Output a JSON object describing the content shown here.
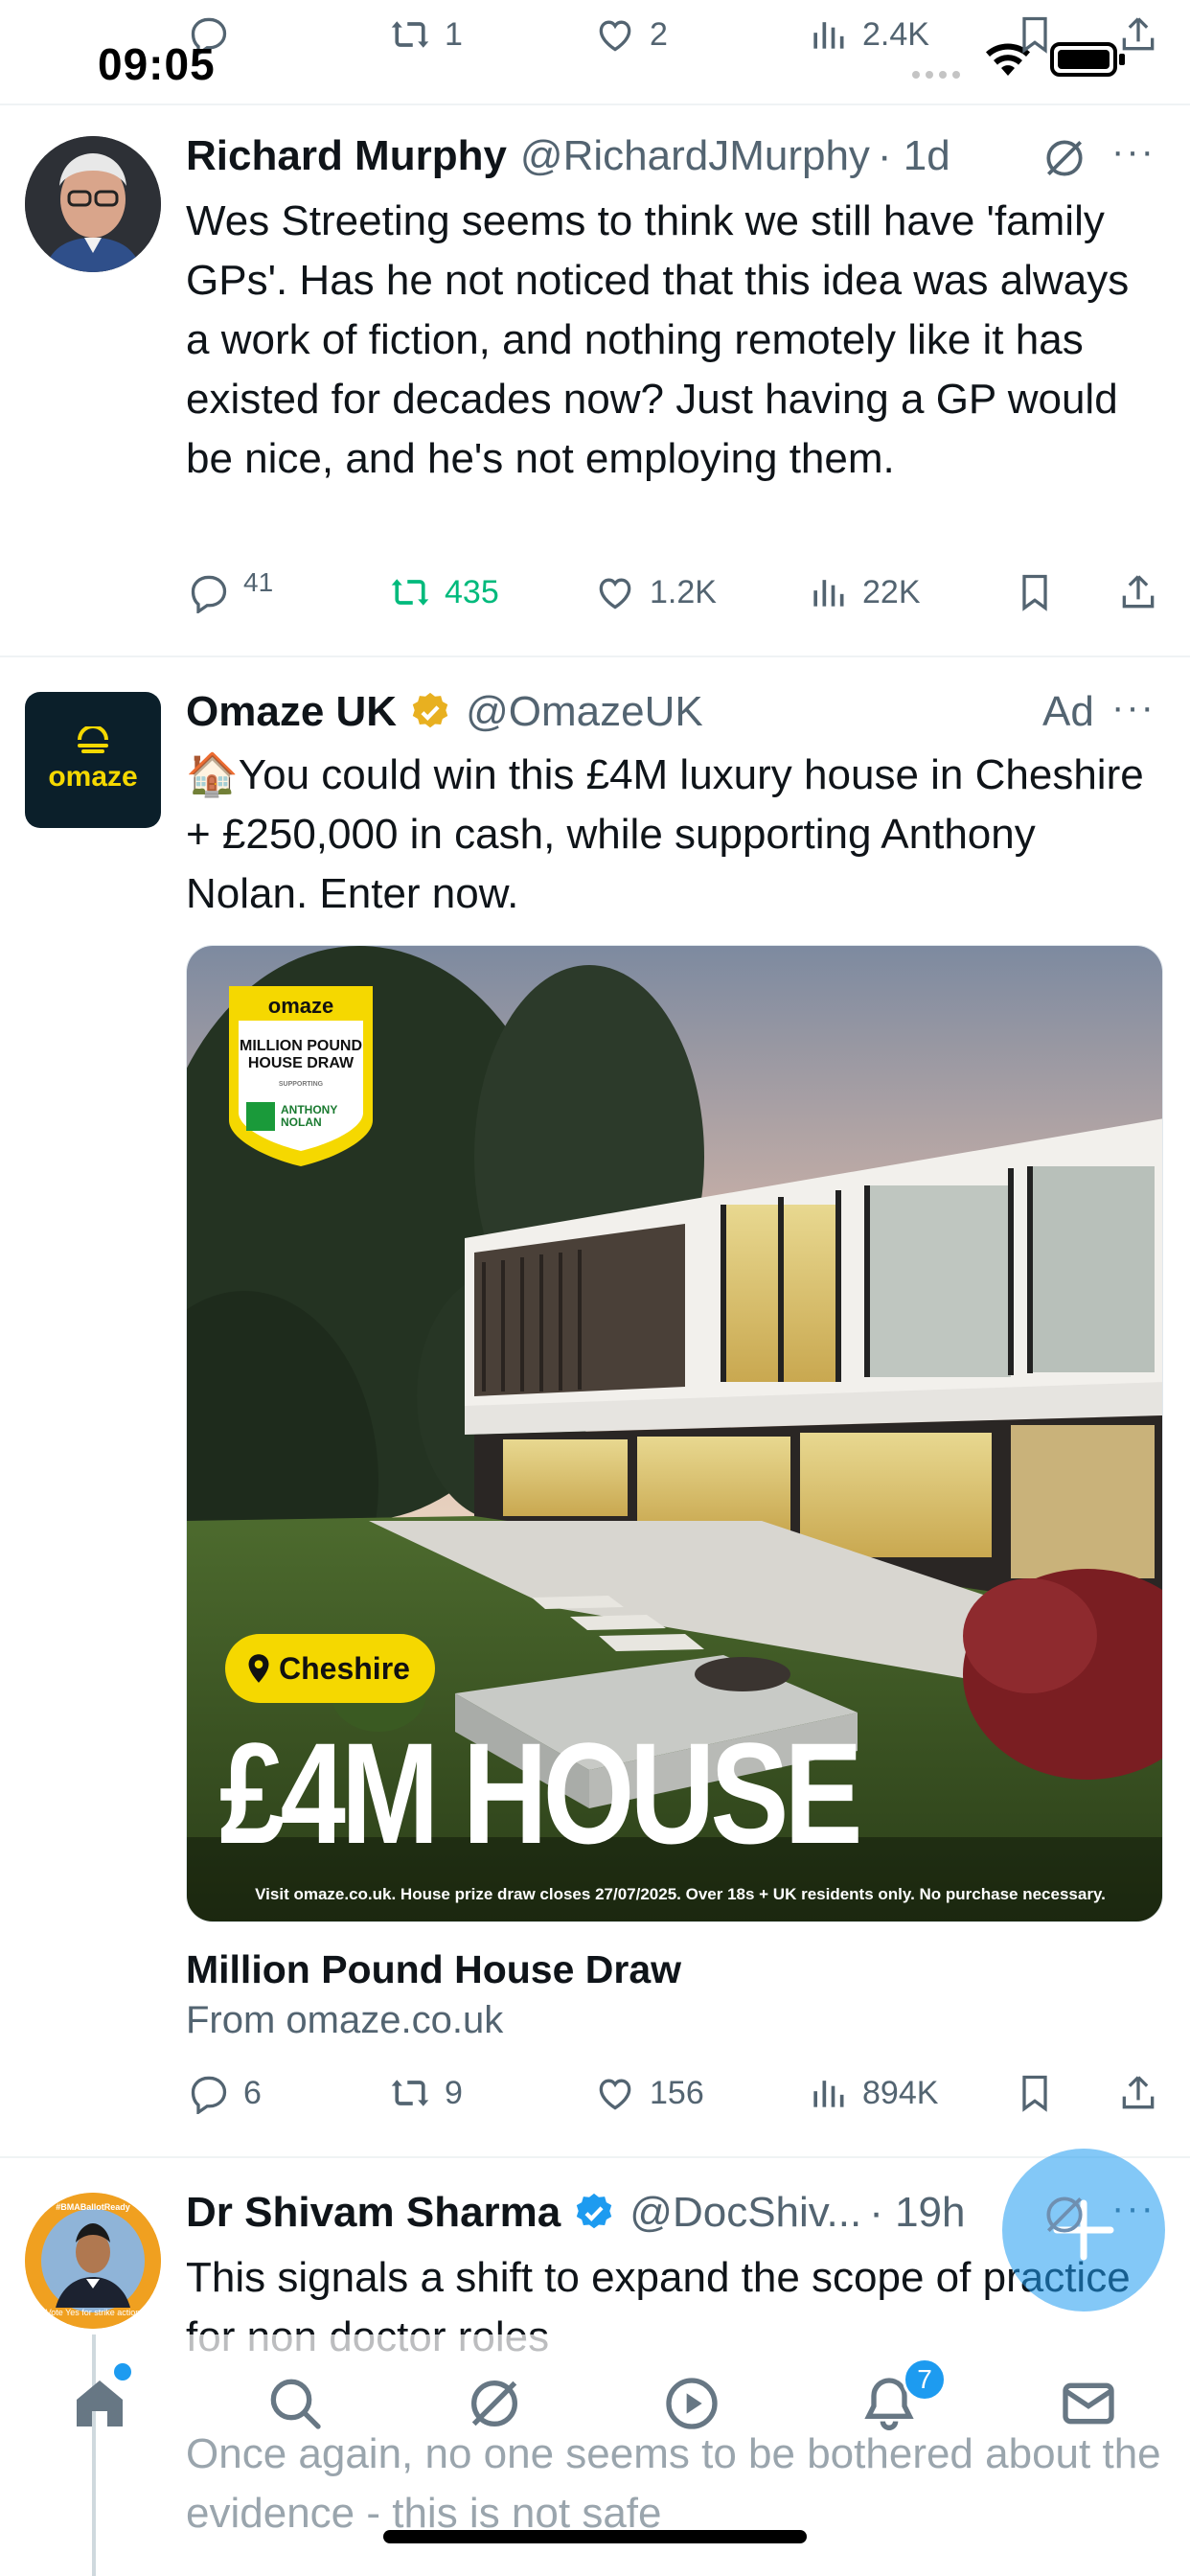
{
  "status_bar": {
    "time": "09:05"
  },
  "prev_tweet_actions": {
    "replies": "",
    "retweets": "1",
    "likes": "2",
    "views": "2.4K"
  },
  "tweets": [
    {
      "name": "Richard Murphy",
      "handle": "@RichardJMurphy",
      "time": "· 1d",
      "text": "Wes Streeting seems to think we still have 'family GPs'. Has he not noticed that this idea was always a work of fiction, and nothing remotely like it has existed for decades now? Just having a GP would be nice, and he's not employing them.",
      "replies": "41",
      "retweets": "435",
      "likes": "1.2K",
      "views": "22K"
    },
    {
      "name": "Omaze UK",
      "handle": "@OmazeUK",
      "ad_label": "Ad",
      "avatar_text": "omaze",
      "text": "🏠You could win this £4M luxury house in Cheshire + £250,000 in cash, while supporting Anthony Nolan. Enter now.",
      "card": {
        "badge_brand": "omaze",
        "badge_line1": "MILLION POUND",
        "badge_line2": "HOUSE DRAW",
        "badge_supporting": "SUPPORTING",
        "badge_partner1": "ANTHONY",
        "badge_partner2": "NOLAN",
        "location": "Cheshire",
        "headline": "£4M HOUSE",
        "fine_print": "Visit omaze.co.uk. House prize draw closes 27/07/2025. Over 18s + UK residents only. No purchase necessary.",
        "title": "Million Pound House Draw",
        "from": "From omaze.co.uk"
      },
      "replies": "6",
      "retweets": "9",
      "likes": "156",
      "views": "894K"
    },
    {
      "name": "Dr Shivam Sharma",
      "handle": "@DocShiv...",
      "time": "· 19h",
      "avatar_ring_text": "Vote Yes for strike action",
      "avatar_ring_top": "#BMABallotReady",
      "text": "This signals a shift to expand the scope of practice for non doctor roles",
      "text2": "Once again, no one seems to be bothered about the evidence - this is not safe"
    }
  ],
  "bottom_nav": {
    "notifications_badge": "7"
  },
  "colors": {
    "accent": "#1d9bf0",
    "retweet_active": "#00ba7c",
    "muted": "#536471",
    "verified_gold": "#e8b020",
    "omaze_yellow": "#f5d800"
  }
}
